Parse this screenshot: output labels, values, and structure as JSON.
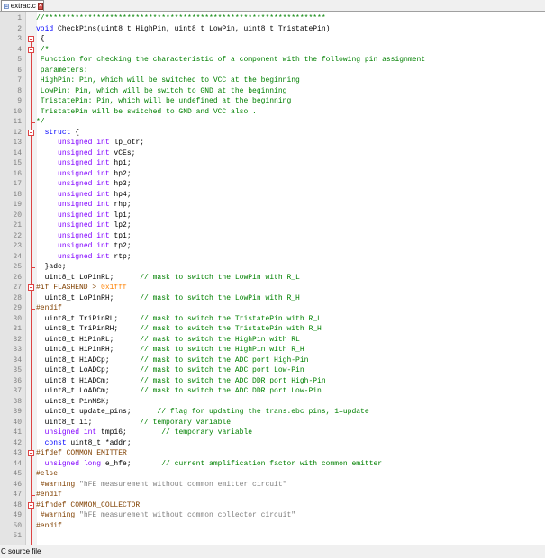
{
  "tab": {
    "filename": "extrac.c"
  },
  "status": {
    "text": "C source file"
  },
  "lines": [
    {
      "n": "1",
      "parts": [
        {
          "c": "c",
          "t": "//*****************************************************************"
        }
      ]
    },
    {
      "n": "2",
      "parts": [
        {
          "c": "k",
          "t": "void"
        },
        {
          "c": "",
          "t": " CheckPins(uint8_t HighPin, uint8_t LowPin, uint8_t TristatePin)"
        }
      ]
    },
    {
      "n": "3",
      "parts": [
        {
          "c": "",
          "t": " {"
        }
      ]
    },
    {
      "n": "4",
      "parts": [
        {
          "c": "c",
          "t": " /*"
        }
      ]
    },
    {
      "n": "5",
      "parts": [
        {
          "c": "c",
          "t": " Function for checking the characteristic of a component with the following pin assignment"
        }
      ]
    },
    {
      "n": "6",
      "parts": [
        {
          "c": "c",
          "t": " parameters:"
        }
      ]
    },
    {
      "n": "7",
      "parts": [
        {
          "c": "c",
          "t": " HighPin: Pin, which will be switched to VCC at the beginning"
        }
      ]
    },
    {
      "n": "8",
      "parts": [
        {
          "c": "c",
          "t": " LowPin: Pin, which will be switch to GND at the beginning"
        }
      ]
    },
    {
      "n": "9",
      "parts": [
        {
          "c": "c",
          "t": " TristatePin: Pin, which will be undefined at the beginning"
        }
      ]
    },
    {
      "n": "10",
      "parts": [
        {
          "c": "c",
          "t": " TristatePin will be switched to GND and VCC also ."
        }
      ]
    },
    {
      "n": "11",
      "parts": [
        {
          "c": "c",
          "t": "*/"
        }
      ]
    },
    {
      "n": "12",
      "parts": [
        {
          "c": "",
          "t": "  "
        },
        {
          "c": "k",
          "t": "struct"
        },
        {
          "c": "",
          "t": " {"
        }
      ]
    },
    {
      "n": "13",
      "parts": [
        {
          "c": "",
          "t": "     "
        },
        {
          "c": "t",
          "t": "unsigned int"
        },
        {
          "c": "",
          "t": " lp_otr;"
        }
      ]
    },
    {
      "n": "14",
      "parts": [
        {
          "c": "",
          "t": "     "
        },
        {
          "c": "t",
          "t": "unsigned int"
        },
        {
          "c": "",
          "t": " vCEs;"
        }
      ]
    },
    {
      "n": "15",
      "parts": [
        {
          "c": "",
          "t": "     "
        },
        {
          "c": "t",
          "t": "unsigned int"
        },
        {
          "c": "",
          "t": " hp1;"
        }
      ]
    },
    {
      "n": "16",
      "parts": [
        {
          "c": "",
          "t": "     "
        },
        {
          "c": "t",
          "t": "unsigned int"
        },
        {
          "c": "",
          "t": " hp2;"
        }
      ]
    },
    {
      "n": "17",
      "parts": [
        {
          "c": "",
          "t": "     "
        },
        {
          "c": "t",
          "t": "unsigned int"
        },
        {
          "c": "",
          "t": " hp3;"
        }
      ]
    },
    {
      "n": "18",
      "parts": [
        {
          "c": "",
          "t": "     "
        },
        {
          "c": "t",
          "t": "unsigned int"
        },
        {
          "c": "",
          "t": " hp4;"
        }
      ]
    },
    {
      "n": "19",
      "parts": [
        {
          "c": "",
          "t": "     "
        },
        {
          "c": "t",
          "t": "unsigned int"
        },
        {
          "c": "",
          "t": " rhp;"
        }
      ]
    },
    {
      "n": "20",
      "parts": [
        {
          "c": "",
          "t": "     "
        },
        {
          "c": "t",
          "t": "unsigned int"
        },
        {
          "c": "",
          "t": " lp1;"
        }
      ]
    },
    {
      "n": "21",
      "parts": [
        {
          "c": "",
          "t": "     "
        },
        {
          "c": "t",
          "t": "unsigned int"
        },
        {
          "c": "",
          "t": " lp2;"
        }
      ]
    },
    {
      "n": "22",
      "parts": [
        {
          "c": "",
          "t": "     "
        },
        {
          "c": "t",
          "t": "unsigned int"
        },
        {
          "c": "",
          "t": " tp1;"
        }
      ]
    },
    {
      "n": "23",
      "parts": [
        {
          "c": "",
          "t": "     "
        },
        {
          "c": "t",
          "t": "unsigned int"
        },
        {
          "c": "",
          "t": " tp2;"
        }
      ]
    },
    {
      "n": "24",
      "parts": [
        {
          "c": "",
          "t": "     "
        },
        {
          "c": "t",
          "t": "unsigned int"
        },
        {
          "c": "",
          "t": " rtp;"
        }
      ]
    },
    {
      "n": "25",
      "parts": [
        {
          "c": "",
          "t": "  }adc;"
        }
      ]
    },
    {
      "n": "26",
      "parts": [
        {
          "c": "",
          "t": "  uint8_t LoPinRL;      "
        },
        {
          "c": "c",
          "t": "// mask to switch the LowPin with R_L"
        }
      ]
    },
    {
      "n": "27",
      "parts": [
        {
          "c": "p",
          "t": "#if FLASHEND > "
        },
        {
          "c": "n",
          "t": "0x1fff"
        }
      ]
    },
    {
      "n": "28",
      "parts": [
        {
          "c": "",
          "t": "  uint8_t LoPinRH;      "
        },
        {
          "c": "c",
          "t": "// mask to switch the LowPin with R_H"
        }
      ]
    },
    {
      "n": "29",
      "parts": [
        {
          "c": "p",
          "t": "#endif"
        }
      ]
    },
    {
      "n": "30",
      "parts": [
        {
          "c": "",
          "t": "  uint8_t TriPinRL;     "
        },
        {
          "c": "c",
          "t": "// mask to switch the TristatePin with R_L"
        }
      ]
    },
    {
      "n": "31",
      "parts": [
        {
          "c": "",
          "t": "  uint8_t TriPinRH;     "
        },
        {
          "c": "c",
          "t": "// mask to switch the TristatePin with R_H"
        }
      ]
    },
    {
      "n": "32",
      "parts": [
        {
          "c": "",
          "t": "  uint8_t HiPinRL;      "
        },
        {
          "c": "c",
          "t": "// mask to switch the HighPin with RL"
        }
      ]
    },
    {
      "n": "33",
      "parts": [
        {
          "c": "",
          "t": "  uint8_t HiPinRH;      "
        },
        {
          "c": "c",
          "t": "// mask to switch the HighPin with R_H"
        }
      ]
    },
    {
      "n": "34",
      "parts": [
        {
          "c": "",
          "t": "  uint8_t HiADCp;       "
        },
        {
          "c": "c",
          "t": "// mask to switch the ADC port High-Pin"
        }
      ]
    },
    {
      "n": "35",
      "parts": [
        {
          "c": "",
          "t": "  uint8_t LoADCp;       "
        },
        {
          "c": "c",
          "t": "// mask to switch the ADC port Low-Pin"
        }
      ]
    },
    {
      "n": "36",
      "parts": [
        {
          "c": "",
          "t": "  uint8_t HiADCm;       "
        },
        {
          "c": "c",
          "t": "// mask to switch the ADC DDR port High-Pin"
        }
      ]
    },
    {
      "n": "37",
      "parts": [
        {
          "c": "",
          "t": "  uint8_t LoADCm;       "
        },
        {
          "c": "c",
          "t": "// mask to switch the ADC DDR port Low-Pin"
        }
      ]
    },
    {
      "n": "38",
      "parts": [
        {
          "c": "",
          "t": "  uint8_t PinMSK;"
        }
      ]
    },
    {
      "n": "39",
      "parts": [
        {
          "c": "",
          "t": "  uint8_t update_pins;      "
        },
        {
          "c": "c",
          "t": "// flag for updating the trans.ebc pins, 1=update"
        }
      ]
    },
    {
      "n": "40",
      "parts": [
        {
          "c": "",
          "t": "  uint8_t ii;           "
        },
        {
          "c": "c",
          "t": "// temporary variable"
        }
      ]
    },
    {
      "n": "41",
      "parts": [
        {
          "c": "",
          "t": "  "
        },
        {
          "c": "t",
          "t": "unsigned int"
        },
        {
          "c": "",
          "t": " tmp16;        "
        },
        {
          "c": "c",
          "t": "// temporary variable"
        }
      ]
    },
    {
      "n": "42",
      "parts": [
        {
          "c": "",
          "t": "  "
        },
        {
          "c": "k",
          "t": "const"
        },
        {
          "c": "",
          "t": " uint8_t *addr;"
        }
      ]
    },
    {
      "n": "43",
      "parts": [
        {
          "c": "p",
          "t": "#ifdef COMMON_EMITTER"
        }
      ]
    },
    {
      "n": "44",
      "parts": [
        {
          "c": "",
          "t": "  "
        },
        {
          "c": "t",
          "t": "unsigned long"
        },
        {
          "c": "",
          "t": " e_hfe;       "
        },
        {
          "c": "c",
          "t": "// current amplification factor with common emitter"
        }
      ]
    },
    {
      "n": "45",
      "parts": [
        {
          "c": "p",
          "t": "#else"
        }
      ]
    },
    {
      "n": "46",
      "parts": [
        {
          "c": "p",
          "t": " #warning "
        },
        {
          "c": "s",
          "t": "\"hFE measurement without common emitter circuit\""
        }
      ]
    },
    {
      "n": "47",
      "parts": [
        {
          "c": "p",
          "t": "#endif"
        }
      ]
    },
    {
      "n": "48",
      "parts": [
        {
          "c": "p",
          "t": "#ifndef COMMON_COLLECTOR"
        }
      ]
    },
    {
      "n": "49",
      "parts": [
        {
          "c": "p",
          "t": " #warning "
        },
        {
          "c": "s",
          "t": "\"hFE measurement without common collector circuit\""
        }
      ]
    },
    {
      "n": "50",
      "parts": [
        {
          "c": "p",
          "t": "#endif"
        }
      ]
    },
    {
      "n": "51",
      "parts": [
        {
          "c": "",
          "t": ""
        }
      ]
    }
  ],
  "colors": {
    "comment": "#008000",
    "keyword": "#0000ff",
    "type": "#8000ff",
    "preprocessor": "#804000",
    "string": "#808080",
    "number": "#ff8000",
    "fold": "#dd4444"
  },
  "icons": [
    "c-file-icon",
    "close-tab-icon"
  ]
}
